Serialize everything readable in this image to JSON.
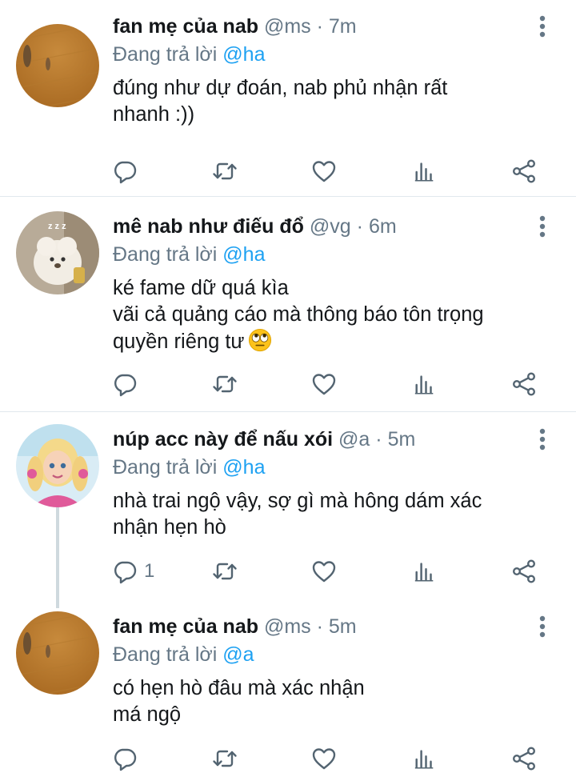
{
  "tweets": [
    {
      "name": "fan mẹ của nab",
      "handle": "@ms",
      "dot": "·",
      "time": "7m",
      "reply_prefix": "Đang trả lời",
      "reply_to": "@ha",
      "text": "đúng như dự đoán, nab phủ nhận rất\nnhanh :))",
      "reply_count": "",
      "avatar": "wood-floor-photo"
    },
    {
      "name": "mê nab như điếu đổ",
      "handle": "@vg",
      "dot": "·",
      "time": "6m",
      "reply_prefix": "Đang trả lời",
      "reply_to": "@ha",
      "text": "ké fame dữ quá kìa\nvãi cả quảng cáo mà thông báo tôn trọng\nquyền riêng tư",
      "emoji": "face-with-rolling-eyes",
      "reply_count": "",
      "avatar": "plush-bear-photo"
    },
    {
      "name": "núp acc này để nấu xói",
      "handle": "@a",
      "dot": "·",
      "time": "5m",
      "reply_prefix": "Đang trả lời",
      "reply_to": "@ha",
      "text": "nhà trai ngộ vậy, sợ gì mà hông dám xác\nnhận hẹn hò",
      "reply_count": "1",
      "avatar": "doll-photo"
    },
    {
      "name": "fan mẹ của nab",
      "handle": "@ms",
      "dot": "·",
      "time": "5m",
      "reply_prefix": "Đang trả lời",
      "reply_to": "@a",
      "text": "có hẹn hò đâu mà xác nhận\nmá ngộ",
      "reply_count": "",
      "avatar": "wood-floor-photo"
    }
  ],
  "colors": {
    "accent": "#1da1f2",
    "secondary_text": "#657786",
    "icon": "#536471",
    "divider": "#e1e8ed"
  },
  "icons": [
    "reply-icon",
    "retweet-icon",
    "like-icon",
    "analytics-icon",
    "share-icon",
    "more-options-icon"
  ]
}
